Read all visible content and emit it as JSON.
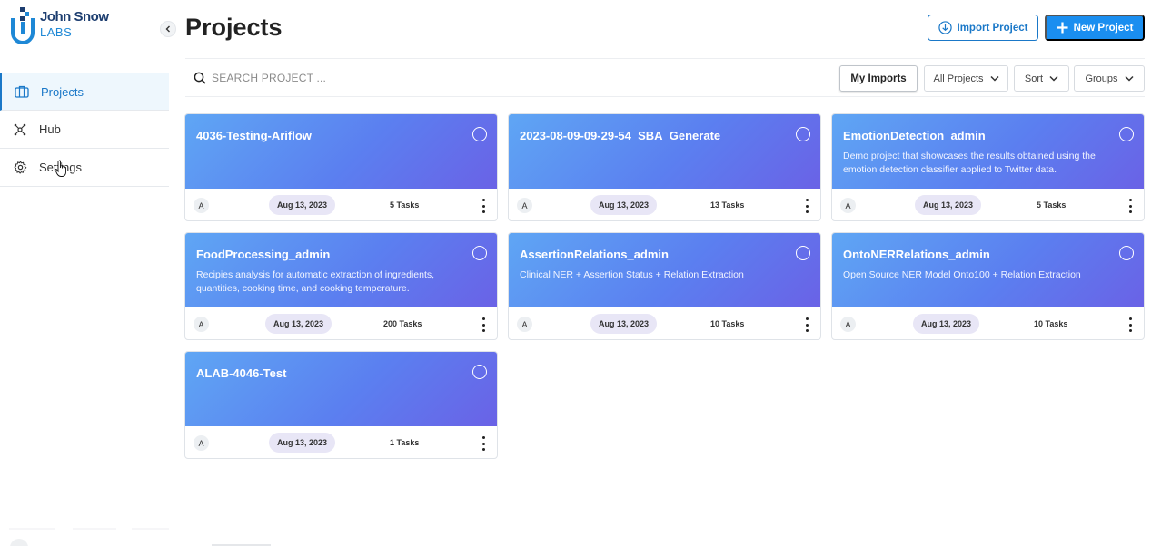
{
  "brand": {
    "line1": "John Snow",
    "line2": "LABS"
  },
  "sidebar": {
    "items": [
      {
        "label": "Projects",
        "icon": "briefcase-icon",
        "active": true
      },
      {
        "label": "Hub",
        "icon": "hub-icon",
        "active": false
      },
      {
        "label": "Settings",
        "icon": "gear-icon",
        "active": false
      }
    ]
  },
  "header": {
    "title": "Projects",
    "import_label": "Import Project",
    "new_label": "New Project"
  },
  "toolbar": {
    "search_placeholder": "SEARCH PROJECT ...",
    "my_imports": "My Imports",
    "all_projects": "All Projects",
    "sort": "Sort",
    "groups": "Groups"
  },
  "projects": [
    {
      "title": "4036-Testing-Ariflow",
      "description": "",
      "owner": "A",
      "date": "Aug 13, 2023",
      "tasks": "5 Tasks"
    },
    {
      "title": "2023-08-09-09-29-54_SBA_Generate",
      "description": "",
      "owner": "A",
      "date": "Aug 13, 2023",
      "tasks": "13 Tasks"
    },
    {
      "title": "EmotionDetection_admin",
      "description": "Demo project that showcases the results obtained using the emotion detection classifier applied to Twitter data.",
      "owner": "A",
      "date": "Aug 13, 2023",
      "tasks": "5 Tasks"
    },
    {
      "title": "FoodProcessing_admin",
      "description": "Recipies analysis for automatic extraction of ingredients, quantities, cooking time, and cooking temperature.",
      "owner": "A",
      "date": "Aug 13, 2023",
      "tasks": "200 Tasks"
    },
    {
      "title": "AssertionRelations_admin",
      "description": "Clinical NER + Assertion Status + Relation Extraction",
      "owner": "A",
      "date": "Aug 13, 2023",
      "tasks": "10 Tasks"
    },
    {
      "title": "OntoNERRelations_admin",
      "description": "Open Source NER Model Onto100 + Relation Extraction",
      "owner": "A",
      "date": "Aug 13, 2023",
      "tasks": "10 Tasks"
    },
    {
      "title": "ALAB-4046-Test",
      "description": "",
      "owner": "A",
      "date": "Aug 13, 2023",
      "tasks": "1 Tasks"
    }
  ],
  "colors": {
    "accent": "#1a78c8",
    "primary_button": "#1a8ef0",
    "card_gradient_start": "#5fa6f4",
    "card_gradient_end": "#6a62e6",
    "date_chip": "#e8e6f6"
  }
}
